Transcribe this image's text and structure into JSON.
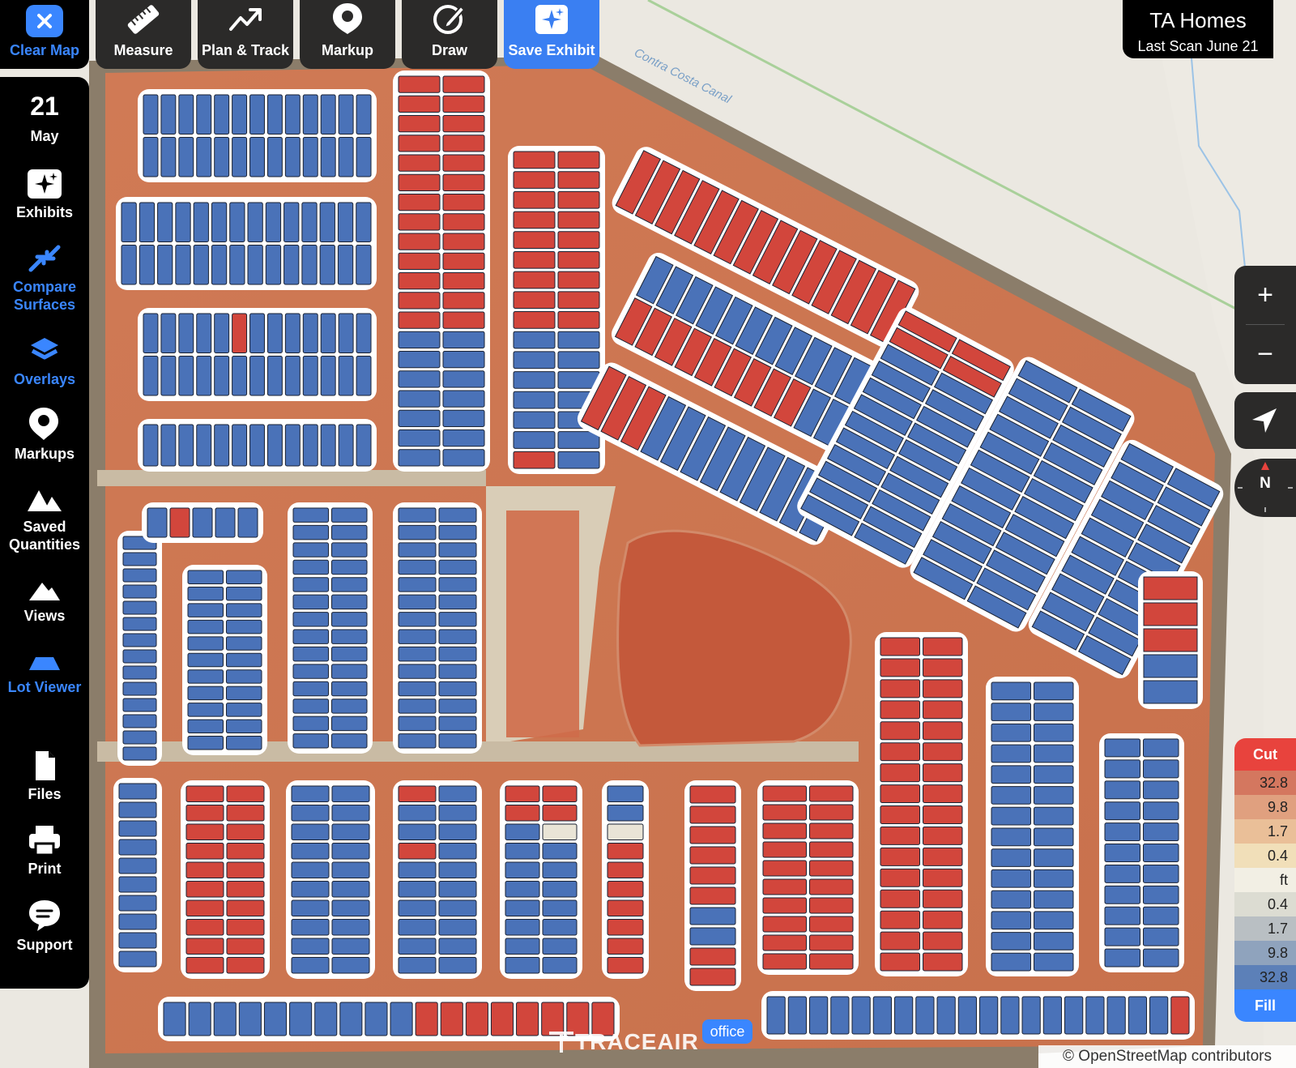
{
  "toolbar": {
    "clear_map": "Clear Map",
    "measure": "Measure",
    "plan_track": "Plan & Track",
    "markup": "Markup",
    "draw": "Draw",
    "save_exhibit": "Save Exhibit"
  },
  "sidebar": {
    "date_day": "21",
    "date_month": "May",
    "exhibits": "Exhibits",
    "compare_line1": "Compare",
    "compare_line2": "Surfaces",
    "overlays": "Overlays",
    "markups": "Markups",
    "saved_line1": "Saved",
    "saved_line2": "Quantities",
    "views": "Views",
    "lot_viewer": "Lot Viewer",
    "files": "Files",
    "print": "Print",
    "support": "Support"
  },
  "project": {
    "name": "TA Homes",
    "last_scan": "Last Scan June 21"
  },
  "controls": {
    "zoom_in": "+",
    "zoom_out": "−",
    "north": "N"
  },
  "legend": {
    "top": "Cut",
    "values": [
      "32.8",
      "9.8",
      "1.7",
      "0.4",
      "ft",
      "0.4",
      "1.7",
      "9.8",
      "32.8"
    ],
    "bottom": "Fill",
    "colors": [
      "#e8433d",
      "#d4775f",
      "#e0a07f",
      "#eabf98",
      "#f1dfb9",
      "#f2efe4",
      "#dcdcd2",
      "#b9bfc3",
      "#8fa3bd",
      "#5c80b8",
      "#3a86ff"
    ]
  },
  "map": {
    "canal_label": "Contra Costa Canal",
    "office_label": "office",
    "brand": "TRACEAIR",
    "attribution": "© OpenStreetMap contributors"
  }
}
